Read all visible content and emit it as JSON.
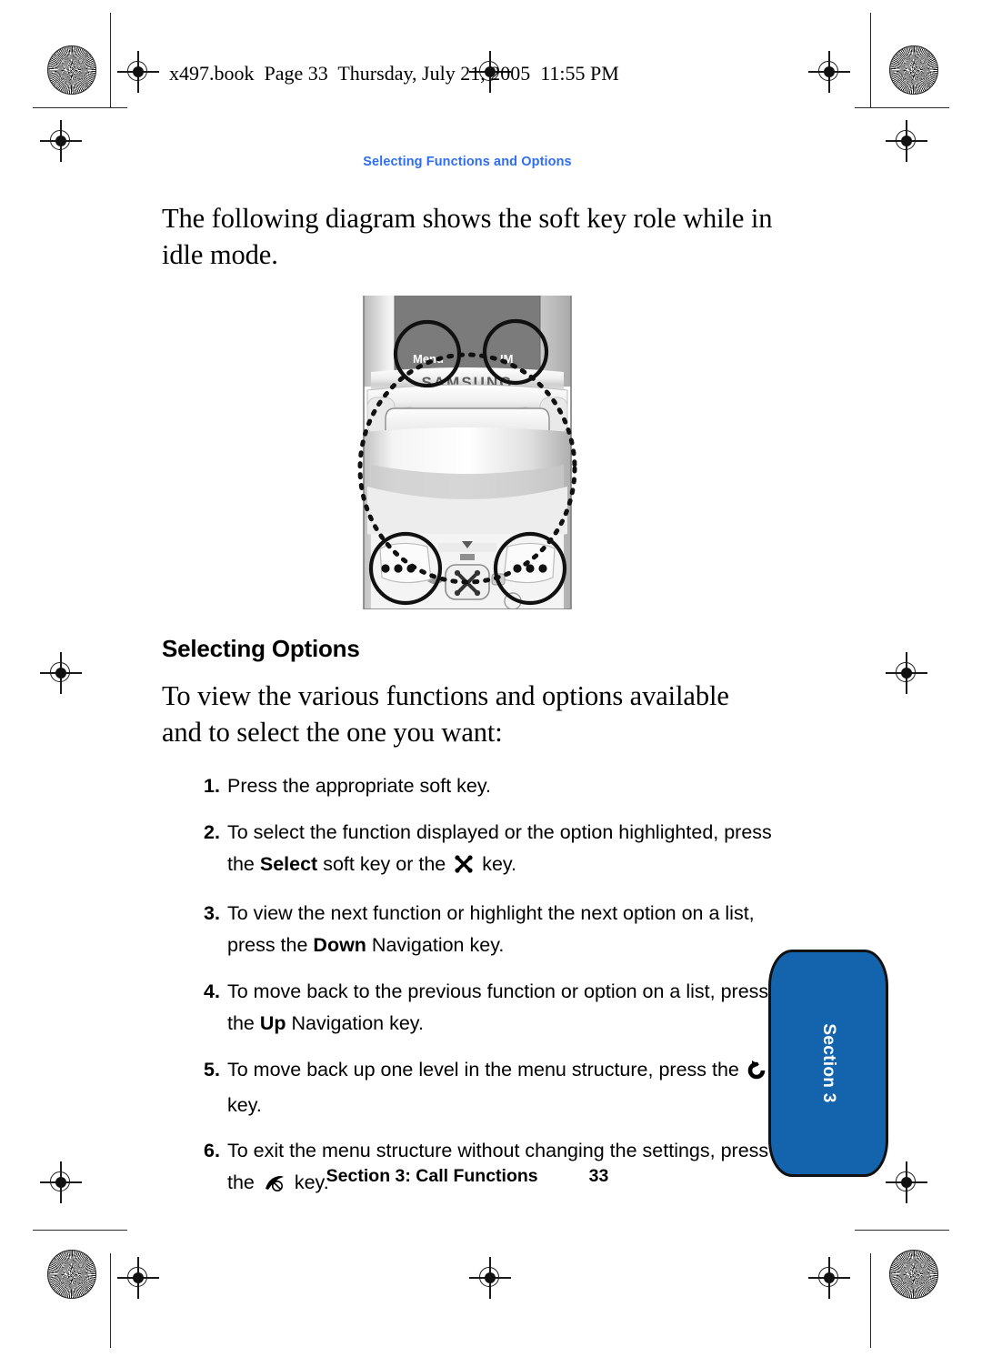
{
  "doc_header": "x497.book  Page 33  Thursday, July 21, 2005  11:55 PM",
  "running_head": "Selecting Functions and Options",
  "intro_paragraph": "The following diagram shows the soft key role while in idle mode.",
  "phone_diagram": {
    "brand": "SAMSUNG",
    "left_softkey_label": "Menu",
    "right_softkey_label": "IM",
    "left_key_mark": "•••",
    "right_key_mark": "•••",
    "center_key_icon": "navigation-ok-key-icon"
  },
  "section_heading": "Selecting Options",
  "section_intro": "To view the various functions and options available and to select the one you want:",
  "steps": [
    {
      "num": "1.",
      "parts": [
        {
          "type": "text",
          "value": "Press the appropriate soft key."
        }
      ]
    },
    {
      "num": "2.",
      "parts": [
        {
          "type": "text",
          "value": "To select the function displayed or the option highlighted, press the "
        },
        {
          "type": "bold",
          "value": "Select"
        },
        {
          "type": "text",
          "value": " soft key or the "
        },
        {
          "type": "icon",
          "value": "ok-select-key-icon"
        },
        {
          "type": "text",
          "value": " key."
        }
      ]
    },
    {
      "num": "3.",
      "parts": [
        {
          "type": "text",
          "value": "To view the next function or highlight the next option on a list, press the "
        },
        {
          "type": "bold",
          "value": "Down"
        },
        {
          "type": "text",
          "value": " Navigation key."
        }
      ]
    },
    {
      "num": "4.",
      "parts": [
        {
          "type": "text",
          "value": "To move back to the previous function or option on a list, press the "
        },
        {
          "type": "bold",
          "value": "Up"
        },
        {
          "type": "text",
          "value": " Navigation key."
        }
      ]
    },
    {
      "num": "5.",
      "parts": [
        {
          "type": "text",
          "value": "To move back up one level in the menu structure, press the "
        },
        {
          "type": "icon",
          "value": "back-key-icon"
        },
        {
          "type": "text",
          "value": " key."
        }
      ]
    },
    {
      "num": "6.",
      "parts": [
        {
          "type": "text",
          "value": "To exit the menu structure without changing the settings, press the "
        },
        {
          "type": "icon",
          "value": "end-call-key-icon"
        },
        {
          "type": "text",
          "value": " key."
        }
      ]
    }
  ],
  "side_tab": {
    "label": "Section 3",
    "color": "#1464ad"
  },
  "footer": {
    "title": "Section 3: Call Functions",
    "page": "33"
  },
  "colors": {
    "running_head_blue": "#2f6ef0",
    "tab_blue": "#1464ad"
  }
}
